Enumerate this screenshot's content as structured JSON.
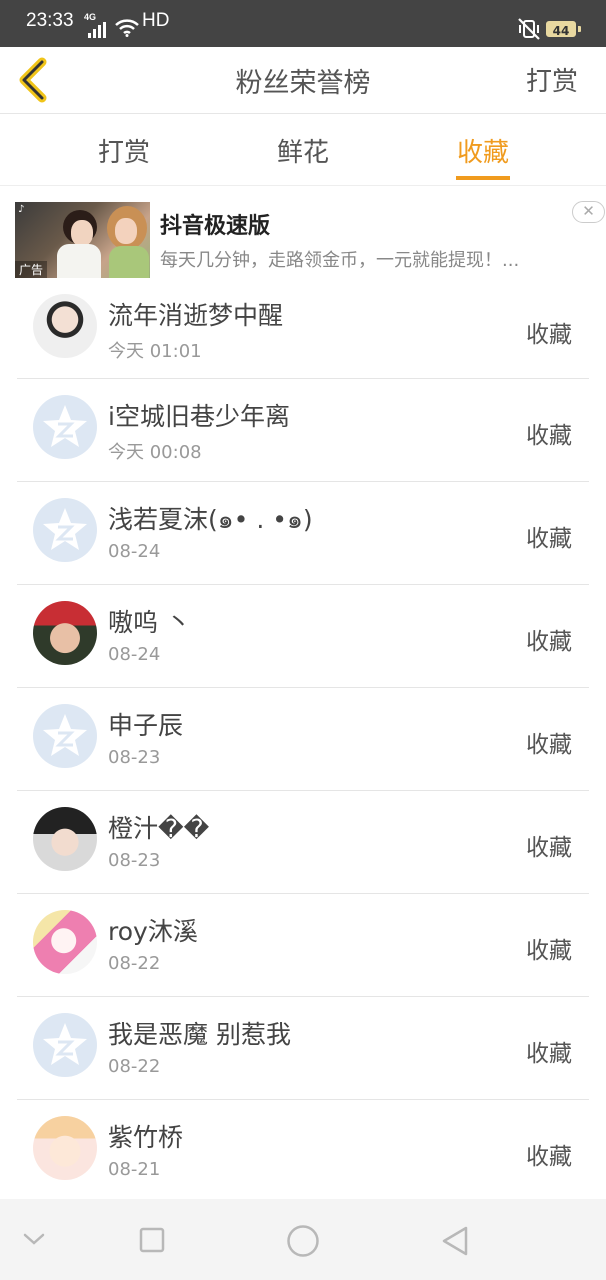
{
  "status_bar": {
    "time": "23:33",
    "signal_label": "4G",
    "network": "HD",
    "battery": "44"
  },
  "header": {
    "title": "粉丝荣誉榜",
    "action_label": "打赏"
  },
  "tabs": [
    {
      "label": "打赏",
      "active": false
    },
    {
      "label": "鲜花",
      "active": false
    },
    {
      "label": "收藏",
      "active": true
    }
  ],
  "ad": {
    "title": "抖音极速版",
    "description": "每天几分钟，走路领金币，一元就能提现！...",
    "tag": "广告"
  },
  "list": [
    {
      "name": "流年消逝梦中醒",
      "date": "今天 01:01",
      "type": "收藏",
      "avatar": "photo"
    },
    {
      "name": "i空城旧巷少年离",
      "date": "今天 00:08",
      "type": "收藏",
      "avatar": "default"
    },
    {
      "name": "浅若夏沫(๑• . •๑)",
      "date": "08-24",
      "type": "收藏",
      "avatar": "default"
    },
    {
      "name": "嗷呜 丶",
      "date": "08-24",
      "type": "收藏",
      "avatar": "photo"
    },
    {
      "name": "申子辰",
      "date": "08-23",
      "type": "收藏",
      "avatar": "default"
    },
    {
      "name": "橙汁��",
      "date": "08-23",
      "type": "收藏",
      "avatar": "photo"
    },
    {
      "name": "roy沐溪",
      "date": "08-22",
      "type": "收藏",
      "avatar": "photo"
    },
    {
      "name": "我是恶魔 别惹我",
      "date": "08-22",
      "type": "收藏",
      "avatar": "default"
    },
    {
      "name": "紫竹桥",
      "date": "08-21",
      "type": "收藏",
      "avatar": "photo"
    }
  ],
  "colors": {
    "accent": "#f09b1e",
    "status_bar_bg": "#444444",
    "default_avatar_bg": "#dde7f3"
  },
  "icons": {
    "back": "chevron-left-icon",
    "default_avatar": "qq-star-icon",
    "nav": [
      "chevron-down-icon",
      "square-icon",
      "circle-icon",
      "triangle-back-icon"
    ]
  }
}
